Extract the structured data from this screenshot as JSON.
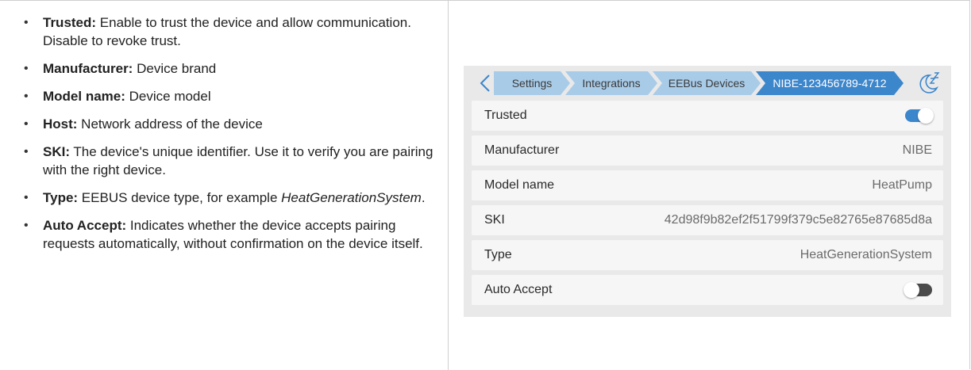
{
  "doc": {
    "items": [
      {
        "term": "Trusted:",
        "text": " Enable to trust the device and allow communication. Disable to revoke trust."
      },
      {
        "term": "Manufacturer:",
        "text": " Device brand"
      },
      {
        "term": "Model name:",
        "text": " Device model"
      },
      {
        "term": "Host:",
        "text": " Network address of the device"
      },
      {
        "term": "SKI:",
        "text": " The device's unique identifier. Use it to verify you are pairing with the right device."
      },
      {
        "term": "Type:",
        "text_before": " EEBUS device type, for example ",
        "text_em": "HeatGenerationSystem",
        "text_after": "."
      },
      {
        "term": "Auto Accept:",
        "text": " Indicates whether the device accepts pairing requests automatically, without confirmation on the device itself."
      }
    ]
  },
  "panel": {
    "breadcrumbs": [
      "Settings",
      "Integrations",
      "EEBus Devices",
      "NIBE-123456789-4712"
    ],
    "back_icon": "chevron-left-icon",
    "sleep_icon": "sleep-icon",
    "accent_color": "#3c86cc",
    "crumb_color": "#a8cbe8",
    "rows": {
      "trusted": {
        "label": "Trusted",
        "toggle": true
      },
      "manufacturer": {
        "label": "Manufacturer",
        "value": "NIBE"
      },
      "model": {
        "label": "Model name",
        "value": "HeatPump"
      },
      "ski": {
        "label": "SKI",
        "value": "42d98f9b82ef2f51799f379c5e82765e87685d8a"
      },
      "type": {
        "label": "Type",
        "value": "HeatGenerationSystem"
      },
      "auto_accept": {
        "label": "Auto Accept",
        "toggle": false
      }
    }
  }
}
